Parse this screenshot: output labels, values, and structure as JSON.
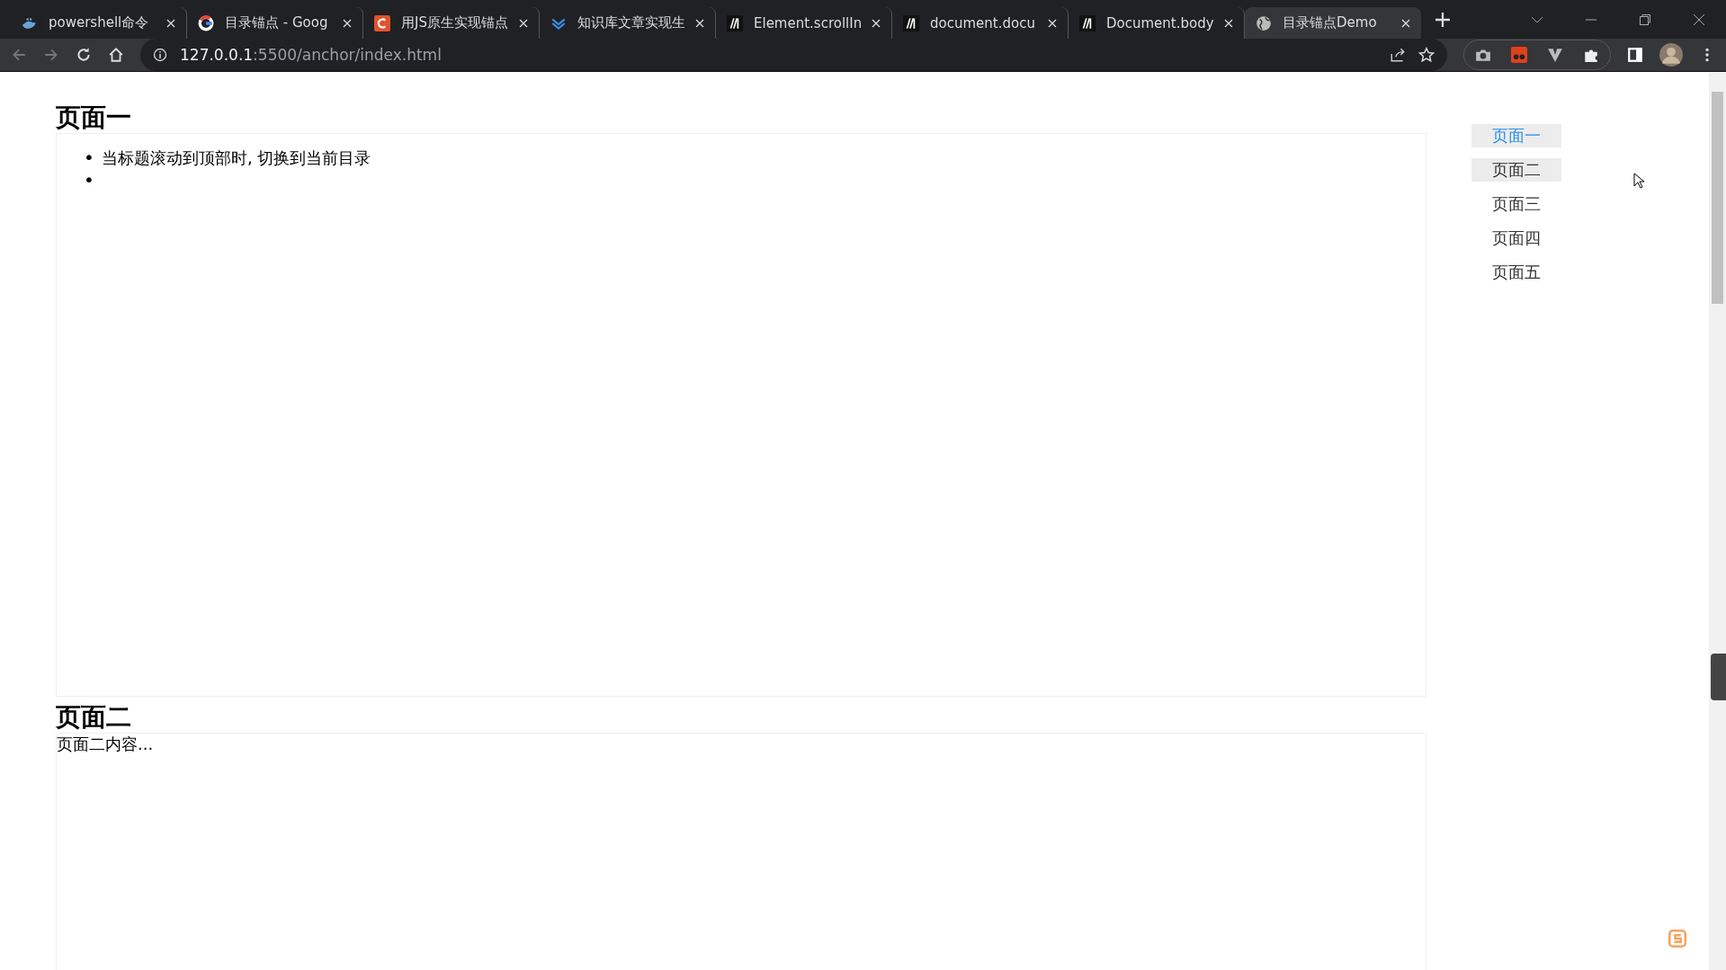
{
  "browser": {
    "tabs": [
      {
        "title": "powershell命令",
        "selected": false
      },
      {
        "title": "目录锚点 - Goog",
        "selected": false
      },
      {
        "title": "用JS原生实现锚点",
        "selected": false
      },
      {
        "title": "知识库文章实现生",
        "selected": false
      },
      {
        "title": "Element.scrollIn",
        "selected": false
      },
      {
        "title": "document.docu",
        "selected": false
      },
      {
        "title": "Document.body",
        "selected": false
      },
      {
        "title": "目录锚点Demo",
        "selected": true
      }
    ],
    "address": {
      "host": "127.0.0.1",
      "rest": ":5500/anchor/index.html"
    }
  },
  "sections": [
    {
      "heading": "页面一",
      "kind": "list",
      "bullets": [
        {
          "marker": "•",
          "text": "当标题滚动到顶部时, 切换到当前目录"
        },
        {
          "marker": "•"
        }
      ]
    },
    {
      "heading": "页面二",
      "kind": "paragraph",
      "text": "页面二内容..."
    }
  ],
  "toc": [
    {
      "label": "页面一",
      "selected": true,
      "hovered": false
    },
    {
      "label": "页面二",
      "selected": false,
      "hovered": true
    },
    {
      "label": "页面三",
      "selected": false,
      "hovered": false
    },
    {
      "label": "页面四",
      "selected": false,
      "hovered": false
    },
    {
      "label": "页面五",
      "selected": false,
      "hovered": false
    }
  ]
}
